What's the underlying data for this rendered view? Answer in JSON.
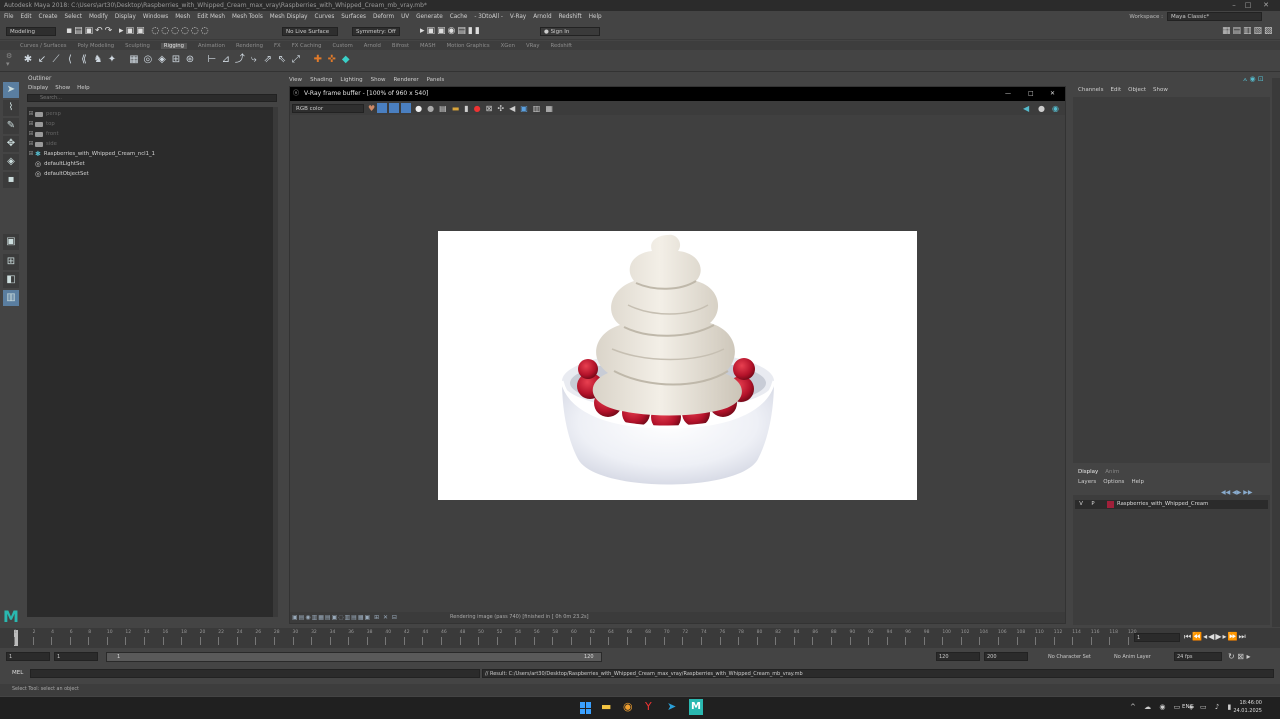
{
  "window": {
    "title": "Autodesk Maya 2018: C:\\Users\\art30\\Desktop\\Raspberries_with_Whipped_Cream_max_vray\\Raspberries_with_Whipped_Cream_mb_vray.mb*",
    "minimize": "–",
    "maximize": "□",
    "close": "✕"
  },
  "menu": [
    "File",
    "Edit",
    "Create",
    "Select",
    "Modify",
    "Display",
    "Windows",
    "Mesh",
    "Edit Mesh",
    "Mesh Tools",
    "Mesh Display",
    "Curves",
    "Surfaces",
    "Deform",
    "UV",
    "Generate",
    "Cache",
    "- 3DtoAll -",
    "V-Ray",
    "Arnold",
    "Redshift",
    "Help"
  ],
  "workspace": {
    "label": "Workspace :",
    "value": "Maya Classic*"
  },
  "status_line": {
    "mode": "Modeling",
    "live_surface": "No Live Surface",
    "symmetry": "Symmetry: Off",
    "sign_in": "Sign In"
  },
  "shelf_tabs": [
    "Curves / Surfaces",
    "Poly Modeling",
    "Sculpting",
    "Rigging",
    "Animation",
    "Rendering",
    "FX",
    "FX Caching",
    "Custom",
    "Arnold",
    "Bifrost",
    "MASH",
    "Motion Graphics",
    "XGen",
    "VRay",
    "Redshift"
  ],
  "shelf_active": "Rigging",
  "outliner": {
    "title": "Outliner",
    "menu": [
      "Display",
      "Show",
      "Help"
    ],
    "search_placeholder": "Search...",
    "items": [
      {
        "label": "persp",
        "dim": true
      },
      {
        "label": "top",
        "dim": true
      },
      {
        "label": "front",
        "dim": true
      },
      {
        "label": "side",
        "dim": true
      },
      {
        "label": "Raspberries_with_Whipped_Cream_ncl1_1",
        "dim": false
      },
      {
        "label": "defaultLightSet",
        "dim": false
      },
      {
        "label": "defaultObjectSet",
        "dim": false
      }
    ]
  },
  "viewport_menu": [
    "View",
    "Shading",
    "Lighting",
    "Show",
    "Renderer",
    "Panels"
  ],
  "vfb": {
    "title": "V-Ray frame buffer - [100% of 960 x 540]",
    "channel": "RGB color",
    "status": "Rendering image (pass 740) [finished in [ 0h  0m 23.2s]"
  },
  "channel_box": {
    "menu": [
      "Channels",
      "Edit",
      "Object",
      "Show"
    ]
  },
  "layer_editor": {
    "tabs": [
      "Display",
      "Anim"
    ],
    "menu": [
      "Layers",
      "Options",
      "Help"
    ],
    "layer": {
      "v": "V",
      "p": "P",
      "name": "Raspberries_with_Whipped_Cream",
      "color": "#a0203a"
    }
  },
  "timeline": {
    "ticks": [
      "1",
      "2",
      "4",
      "6",
      "8",
      "10",
      "12",
      "14",
      "16",
      "18",
      "20",
      "22",
      "24",
      "26",
      "28",
      "30",
      "32",
      "34",
      "36",
      "38",
      "40",
      "42",
      "44",
      "46",
      "48",
      "50",
      "52",
      "54",
      "56",
      "58",
      "60",
      "62",
      "64",
      "66",
      "68",
      "70",
      "72",
      "74",
      "76",
      "78",
      "80",
      "82",
      "84",
      "86",
      "88",
      "90",
      "92",
      "94",
      "96",
      "98",
      "100",
      "102",
      "104",
      "106",
      "108",
      "110",
      "112",
      "114",
      "116",
      "118",
      "120"
    ],
    "current_frame": "1"
  },
  "range": {
    "start": "1",
    "anim_start": "1",
    "slider_start": "1",
    "slider_end": "120",
    "end": "120",
    "anim_end": "200",
    "character": "No Character Set",
    "anim_layer": "No Anim Layer",
    "fps": "24 fps"
  },
  "command": {
    "lang": "MEL",
    "result": "// Result: C:/Users/art30/Desktop/Raspberries_with_Whipped_Cream_max_vray/Raspberries_with_Whipped_Cream_mb_vray.mb"
  },
  "help_line": "Select Tool: select an object",
  "taskbar": {
    "lang": "ENG",
    "time": "18:46:00",
    "date": "24.01.2025"
  }
}
